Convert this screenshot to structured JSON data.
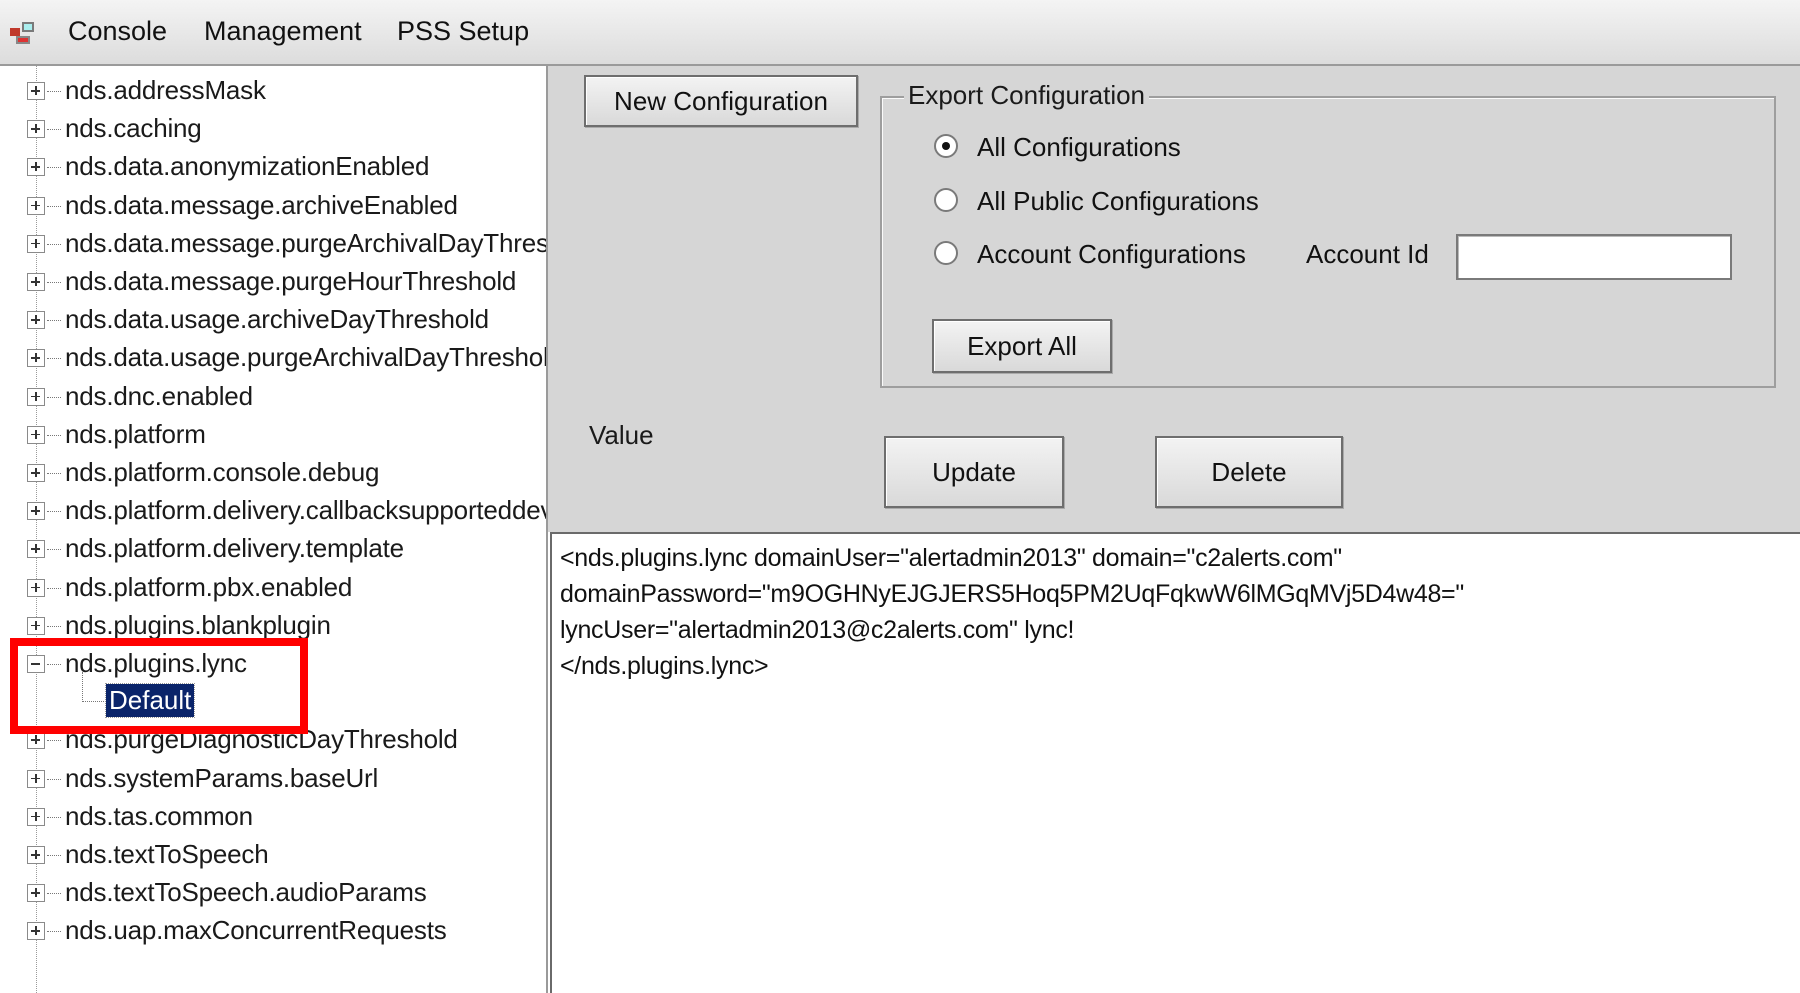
{
  "menu": {
    "items": [
      "Console",
      "Management",
      "PSS Setup"
    ]
  },
  "tree": {
    "items": [
      {
        "label": "nds.addressMask",
        "expanded": false
      },
      {
        "label": "nds.caching",
        "expanded": false
      },
      {
        "label": "nds.data.anonymizationEnabled",
        "expanded": false
      },
      {
        "label": "nds.data.message.archiveEnabled",
        "expanded": false
      },
      {
        "label": "nds.data.message.purgeArchivalDayThres",
        "expanded": false
      },
      {
        "label": "nds.data.message.purgeHourThreshold",
        "expanded": false
      },
      {
        "label": "nds.data.usage.archiveDayThreshold",
        "expanded": false
      },
      {
        "label": "nds.data.usage.purgeArchivalDayThreshol",
        "expanded": false
      },
      {
        "label": "nds.dnc.enabled",
        "expanded": false
      },
      {
        "label": "nds.platform",
        "expanded": false
      },
      {
        "label": "nds.platform.console.debug",
        "expanded": false
      },
      {
        "label": "nds.platform.delivery.callbacksupporteddev",
        "expanded": false
      },
      {
        "label": "nds.platform.delivery.template",
        "expanded": false
      },
      {
        "label": "nds.platform.pbx.enabled",
        "expanded": false
      },
      {
        "label": "nds.plugins.blankplugin",
        "expanded": false
      },
      {
        "label": "nds.plugins.lync",
        "expanded": true
      },
      {
        "label": "nds.purgeDiagnosticDayThreshold",
        "expanded": false
      },
      {
        "label": "nds.systemParams.baseUrl",
        "expanded": false
      },
      {
        "label": "nds.tas.common",
        "expanded": false
      },
      {
        "label": "nds.textToSpeech",
        "expanded": false
      },
      {
        "label": "nds.textToSpeech.audioParams",
        "expanded": false
      },
      {
        "label": "nds.uap.maxConcurrentRequests",
        "expanded": false
      }
    ],
    "selected_child": "Default"
  },
  "toolbar": {
    "new_config_label": "New Configuration"
  },
  "export": {
    "title": "Export Configuration",
    "options": [
      {
        "label": "All Configurations",
        "checked": true
      },
      {
        "label": "All Public Configurations",
        "checked": false
      },
      {
        "label": "Account Configurations",
        "checked": false
      }
    ],
    "account_id_label": "Account Id",
    "account_id_value": "",
    "export_all_label": "Export All"
  },
  "value": {
    "label": "Value",
    "update_label": "Update",
    "delete_label": "Delete",
    "lines": [
      "<nds.plugins.lync domainUser=\"alertadmin2013\" domain=\"c2alerts.com\"",
      "    domainPassword=\"m9OGHNyEJGJERS5Hoq5PM2UqFqkwW6lMGqMVj5D4w48=\"",
      "    lyncUser=\"alertadmin2013@c2alerts.com\" lync!",
      "</nds.plugins.lync>"
    ]
  },
  "colors": {
    "selection": "#0a246a",
    "highlight_border": "#ff0000",
    "panel_bg": "#d6d6d6"
  }
}
